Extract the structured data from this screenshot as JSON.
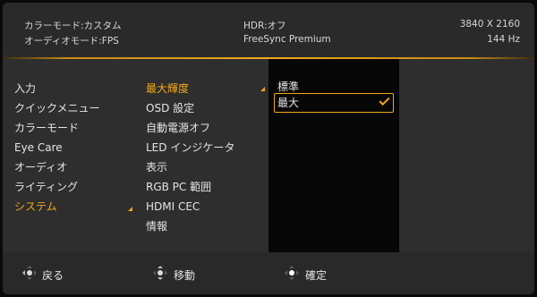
{
  "header": {
    "color_mode": "カラーモード:カスタム",
    "audio_mode": "オーディオモード:FPS",
    "hdr": "HDR:オフ",
    "freesync": "FreeSync Premium",
    "resolution": "3840 X 2160",
    "refresh_rate": "144 Hz"
  },
  "menu": {
    "main_items": [
      "入力",
      "クイックメニュー",
      "カラーモード",
      "Eye Care",
      "オーディオ",
      "ライティング",
      "システム"
    ],
    "main_selected": "システム",
    "sub_items": [
      "最大輝度",
      "OSD 設定",
      "自動電源オフ",
      "LED インジケータ",
      "表示",
      "RGB PC 範囲",
      "HDMI CEC",
      "情報"
    ],
    "sub_selected": "最大輝度",
    "options": [
      "標準",
      "最大"
    ],
    "option_selected": "最大"
  },
  "footer": {
    "back_label": "戻る",
    "move_label": "移動",
    "confirm_label": "確定"
  },
  "colors": {
    "accent": "#f2a818",
    "panel": "#2e2e2e",
    "option_panel": "#070707"
  },
  "icons": {
    "checkmark": "check-icon",
    "back": "dpad-left-icon",
    "move": "dpad-updown-icon",
    "confirm": "dpad-center-icon"
  }
}
